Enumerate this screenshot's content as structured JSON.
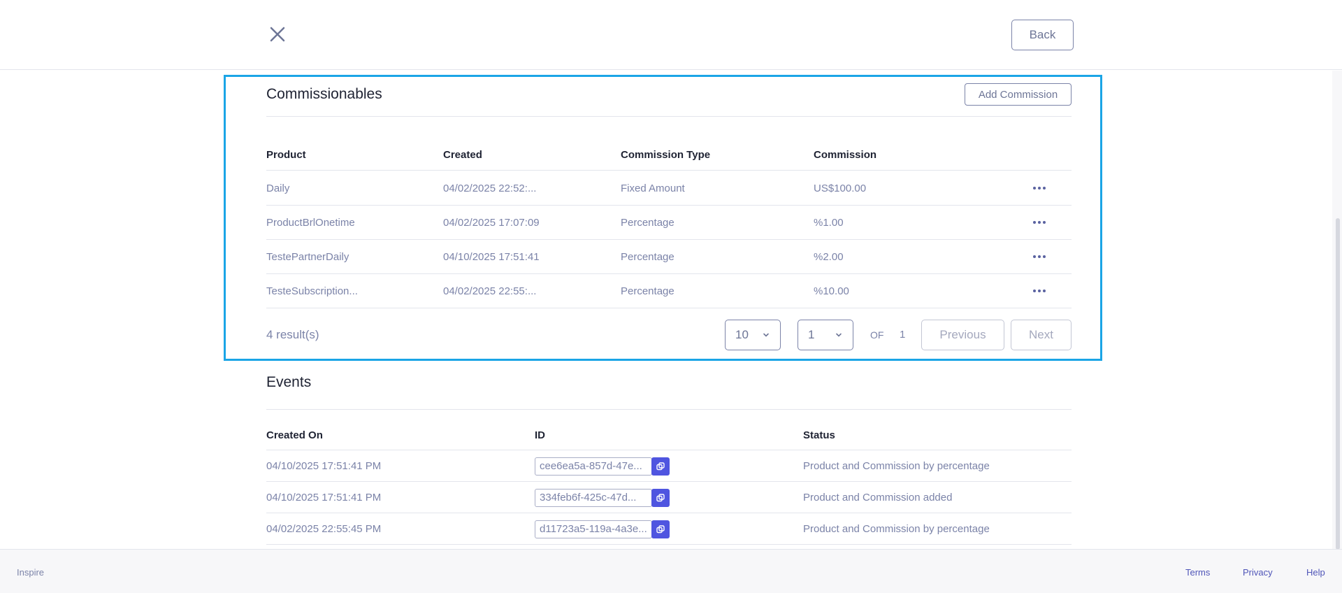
{
  "header": {
    "close_icon": "close-icon",
    "back_label": "Back"
  },
  "commissionables": {
    "title": "Commissionables",
    "add_label": "Add Commission",
    "columns": [
      "Product",
      "Created",
      "Commission Type",
      "Commission"
    ],
    "rows": [
      {
        "product": "Daily",
        "created": "04/02/2025 22:52:...",
        "type": "Fixed Amount",
        "commission": "US$100.00"
      },
      {
        "product": "ProductBrlOnetime",
        "created": "04/02/2025 17:07:09",
        "type": "Percentage",
        "commission": "%1.00"
      },
      {
        "product": "TestePartnerDaily",
        "created": "04/10/2025 17:51:41",
        "type": "Percentage",
        "commission": "%2.00"
      },
      {
        "product": "TesteSubscription...",
        "created": "04/02/2025 22:55:...",
        "type": "Percentage",
        "commission": "%10.00"
      }
    ],
    "row_menu_icon": "more-horizontal-icon",
    "results": "4 result(s)",
    "page_size": "10",
    "page": "1",
    "of_label": "OF",
    "total_pages": "1",
    "previous_label": "Previous",
    "next_label": "Next"
  },
  "events": {
    "title": "Events",
    "columns": [
      "Created On",
      "ID",
      "Status"
    ],
    "rows": [
      {
        "created_on": "04/10/2025 17:51:41 PM",
        "id": "cee6ea5a-857d-47e...",
        "status": "Product and Commission by percentage"
      },
      {
        "created_on": "04/10/2025 17:51:41 PM",
        "id": "334feb6f-425c-47d...",
        "status": "Product and Commission added"
      },
      {
        "created_on": "04/02/2025 22:55:45 PM",
        "id": "d11723a5-119a-4a3e...",
        "status": "Product and Commission by percentage"
      }
    ],
    "copy_icon": "copy-icon"
  },
  "footer": {
    "brand": "Inspire",
    "terms": "Terms",
    "privacy": "Privacy",
    "help": "Help"
  },
  "colors": {
    "highlight": "#1ba5e6",
    "accent": "#4f55e0",
    "muted_text": "#7b83a8"
  }
}
